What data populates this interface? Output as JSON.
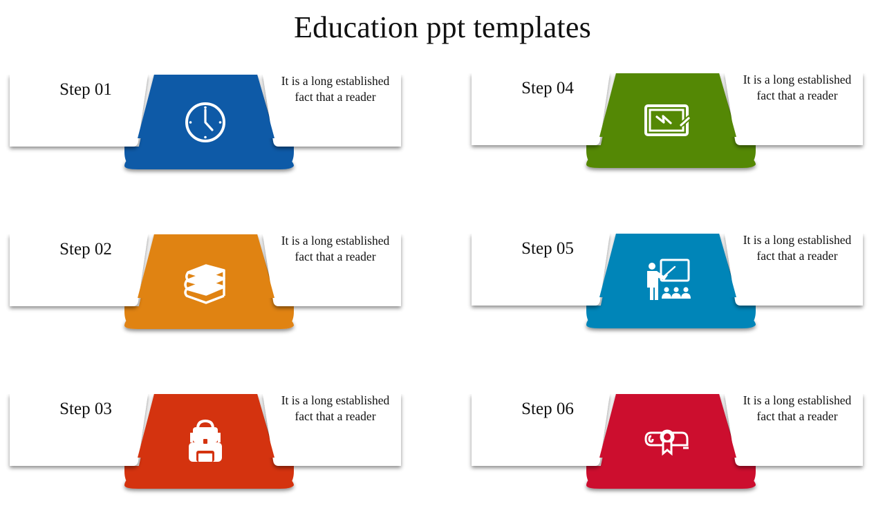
{
  "title": "Education ppt templates",
  "steps": [
    {
      "label": "Step 01",
      "desc_line1": "It is a long established",
      "desc_line2": "fact that a reader",
      "color": "#0E5AA7",
      "icon": "clock-icon"
    },
    {
      "label": "Step 02",
      "desc_line1": "It is a long established",
      "desc_line2": "fact that a reader",
      "color": "#E08312",
      "icon": "books-icon"
    },
    {
      "label": "Step 03",
      "desc_line1": "It is a long established",
      "desc_line2": "fact that a reader",
      "color": "#D4330F",
      "icon": "backpack-icon"
    },
    {
      "label": "Step 04",
      "desc_line1": "It is a long established",
      "desc_line2": "fact that a reader",
      "color": "#548805",
      "icon": "whiteboard-icon"
    },
    {
      "label": "Step 05",
      "desc_line1": "It is a long established",
      "desc_line2": "fact that a reader",
      "color": "#0085B8",
      "icon": "teacher-icon"
    },
    {
      "label": "Step 06",
      "desc_line1": "It is a long established",
      "desc_line2": "fact that a reader",
      "color": "#CC0E2E",
      "icon": "diploma-icon"
    }
  ]
}
